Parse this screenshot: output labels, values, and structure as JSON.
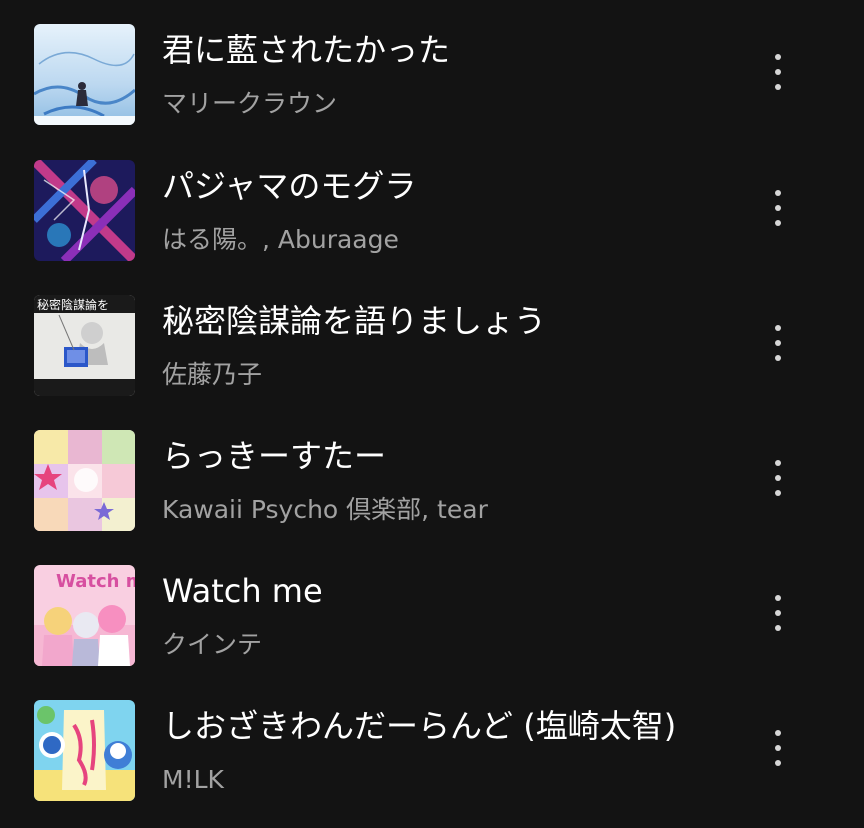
{
  "tracks": [
    {
      "title": "君に藍されたかった",
      "artist": "マリークラウン",
      "cover_icon": "album-cover"
    },
    {
      "title": "パジャマのモグラ",
      "artist": "はる陽。, Aburaage",
      "cover_icon": "album-cover"
    },
    {
      "title": "秘密陰謀論を語りましょう",
      "artist": "佐藤乃子",
      "cover_icon": "album-cover",
      "cover_text": "秘密陰謀論を"
    },
    {
      "title": "らっきーすたー",
      "artist": "Kawaii Psycho 倶楽部, tear",
      "cover_icon": "album-cover"
    },
    {
      "title": "Watch me",
      "artist": "クインテ",
      "cover_icon": "album-cover",
      "cover_text": "Watch me"
    },
    {
      "title": "しおざきわんだーらんど (塩崎太智)",
      "artist": "M!LK",
      "cover_icon": "album-cover"
    }
  ],
  "more_icon": "more-vertical-icon"
}
